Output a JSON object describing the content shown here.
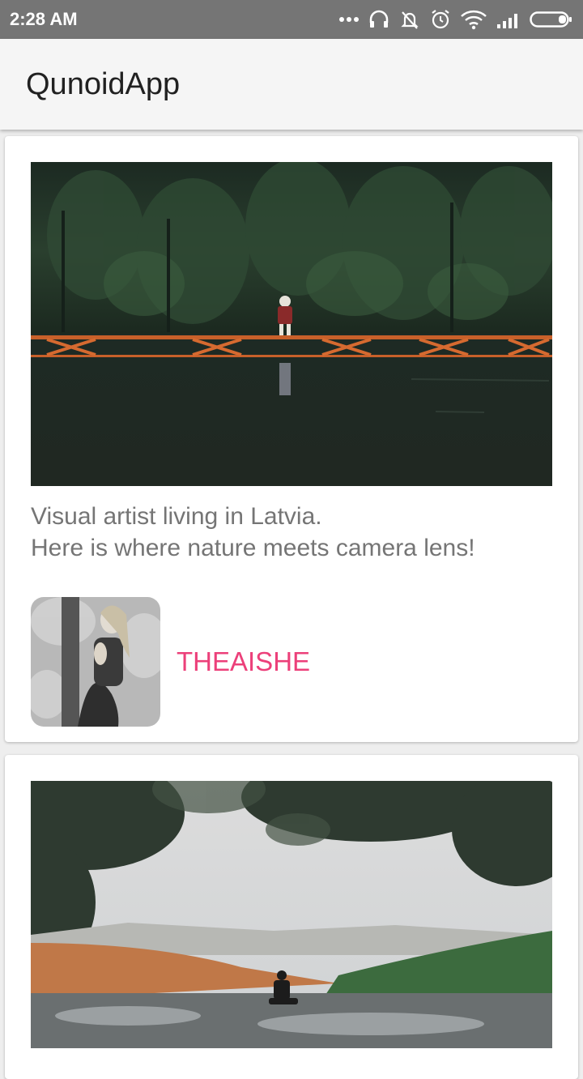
{
  "status_bar": {
    "time": "2:28 AM",
    "icons": [
      "more-dots-icon",
      "headset-icon",
      "notifications-off-icon",
      "alarm-icon",
      "wifi-icon",
      "signal-icon",
      "battery-icon"
    ]
  },
  "app_bar": {
    "title": "QunoidApp"
  },
  "posts": [
    {
      "description_lines": [
        "Visual artist living in Latvia.",
        "Here is where nature meets camera lens!"
      ],
      "author": "THEAISHE"
    }
  ],
  "colors": {
    "status_bar": "#757575",
    "app_bar": "#f5f5f5",
    "accent": "#ec407a",
    "body_text": "#757575",
    "background": "#eeeeee"
  }
}
